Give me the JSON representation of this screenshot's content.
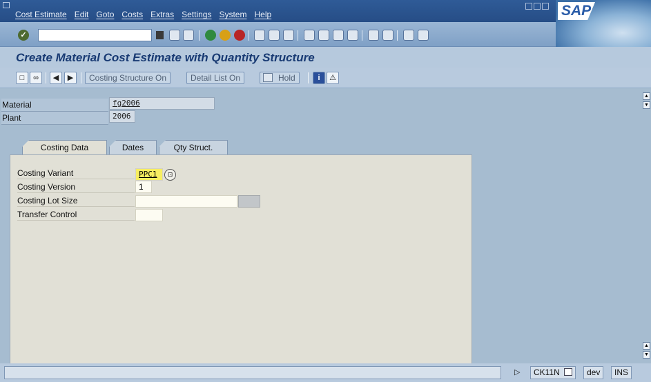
{
  "menu": {
    "items": [
      "Cost Estimate",
      "Edit",
      "Goto",
      "Costs",
      "Extras",
      "Settings",
      "System",
      "Help"
    ]
  },
  "logo": "SAP",
  "title": "Create Material Cost Estimate with Quantity Structure",
  "app_toolbar": {
    "costing_structure_label": "Costing Structure On",
    "detail_list_label": "Detail List On",
    "hold_label": "Hold"
  },
  "header": {
    "material_label": "Material",
    "material_value": "fg2006",
    "plant_label": "Plant",
    "plant_value": "2006"
  },
  "tabs": [
    {
      "label": "Costing Data",
      "active": true
    },
    {
      "label": "Dates",
      "active": false
    },
    {
      "label": "Qty Struct.",
      "active": false
    }
  ],
  "costing": {
    "variant_label": "Costing Variant",
    "variant_value": "PPC1",
    "version_label": "Costing Version",
    "version_value": "1",
    "lot_size_label": "Costing Lot Size",
    "lot_size_value": "",
    "transfer_label": "Transfer Control",
    "transfer_value": ""
  },
  "status": {
    "transaction": "CK11N",
    "system": "dev",
    "mode": "INS"
  },
  "colors": {
    "menubar": "#2f5b97",
    "title_text": "#183a73",
    "background": "#a6bcd0",
    "highlight_field": "#f7ee61"
  }
}
